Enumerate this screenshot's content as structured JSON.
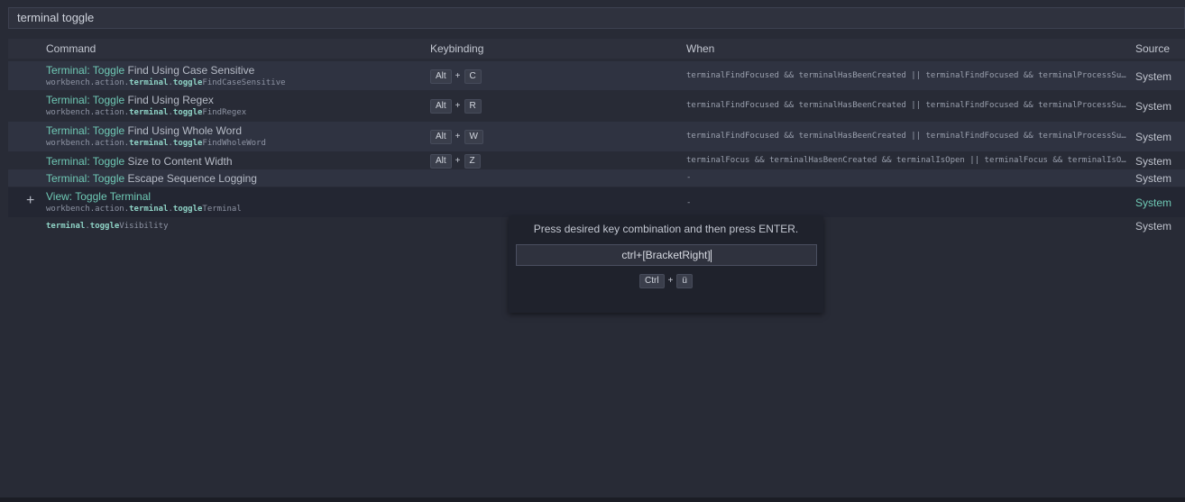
{
  "search": {
    "value": "terminal toggle"
  },
  "columns": {
    "command": "Command",
    "keybinding": "Keybinding",
    "when": "When",
    "source": "Source"
  },
  "rows": [
    {
      "title_prefix": "Terminal: Toggle",
      "title_rest": " Find Using Case Sensitive",
      "id_a": "workbench.action.",
      "id_b": "terminal",
      "id_c": ".",
      "id_d": "toggle",
      "id_e": "FindCaseSensitive",
      "key1": "Alt",
      "plus": "+",
      "key2": "C",
      "when": "terminalFindFocused && terminalHasBeenCreated || terminalFindFocused && terminalProcessSupported || terminalFocusInAny && terminalHasBeenCreated || terminalFocusInAny && terminalProcessSupported",
      "source": "System"
    },
    {
      "title_prefix": "Terminal: Toggle",
      "title_rest": " Find Using Regex",
      "id_a": "workbench.action.",
      "id_b": "terminal",
      "id_c": ".",
      "id_d": "toggle",
      "id_e": "FindRegex",
      "key1": "Alt",
      "plus": "+",
      "key2": "R",
      "when": "terminalFindFocused && terminalHasBeenCreated || terminalFindFocused && terminalProcessSupported || terminalFocusInAny && terminalHasBeenCreated || terminalFocusInAny && terminalProcessSupported",
      "source": "System"
    },
    {
      "title_prefix": "Terminal: Toggle",
      "title_rest": " Find Using Whole Word",
      "id_a": "workbench.action.",
      "id_b": "terminal",
      "id_c": ".",
      "id_d": "toggle",
      "id_e": "FindWholeWord",
      "key1": "Alt",
      "plus": "+",
      "key2": "W",
      "when": "terminalFindFocused && terminalHasBeenCreated || terminalFindFocused && terminalProcessSupported || terminalFocusInAny && terminalHasBeenCreated || terminalFocusInAny && terminalProcessSupported",
      "source": "System"
    },
    {
      "title_prefix": "Terminal: Toggle",
      "title_rest": " Size to Content Width",
      "key1": "Alt",
      "plus": "+",
      "key2": "Z",
      "when": "terminalFocus && terminalHasBeenCreated && terminalIsOpen || terminalFocus && terminalIsOpen && terminalProcessSupported",
      "source": "System"
    },
    {
      "title_prefix": "Terminal: Toggle",
      "title_rest": " Escape Sequence Logging",
      "when": "-",
      "source": "System"
    },
    {
      "title_a": "View: ",
      "title_b": "Toggle Terminal",
      "id_a": "workbench.action.",
      "id_b": "terminal",
      "id_c": ".",
      "id_d": "toggle",
      "id_e": "Terminal",
      "when": "-",
      "source": "System"
    },
    {
      "id_b": "terminal",
      "id_c": ".",
      "id_d": "toggle",
      "id_e": "Visibility",
      "source": "System"
    }
  ],
  "dialog": {
    "message": "Press desired key combination and then press ENTER.",
    "input_value": "ctrl+[BracketRight]",
    "key1": "Ctrl",
    "plus": "+",
    "key2": "ü"
  },
  "colors": {
    "highlight": "#6fc9b5",
    "background": "#282b36",
    "dialog_bg": "#1f222c"
  },
  "icons": {
    "add": "plus-icon"
  }
}
